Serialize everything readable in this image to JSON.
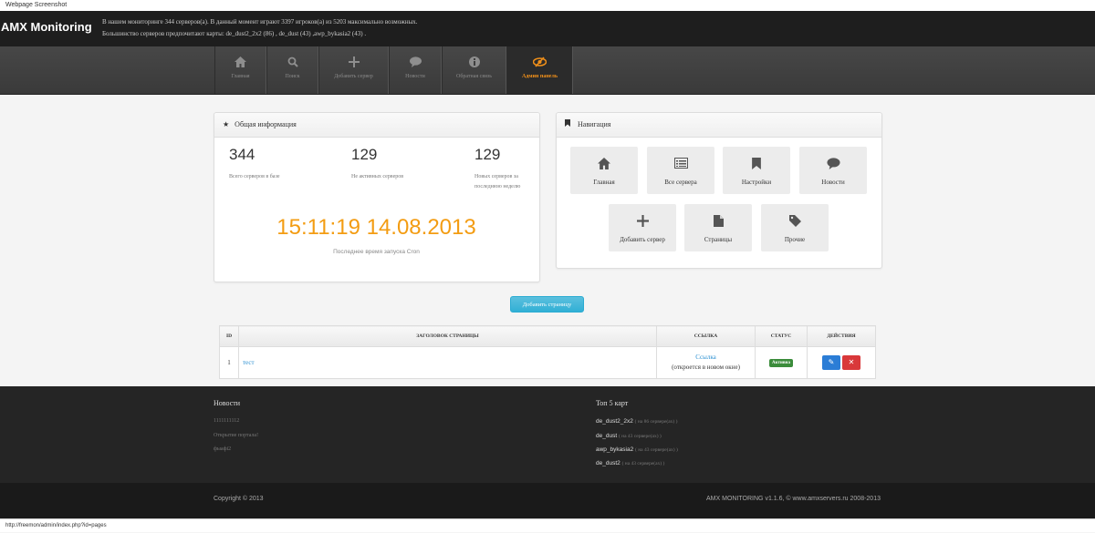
{
  "window_title": "Webpage Screenshot",
  "brand": "AMX Monitoring",
  "top_info": {
    "line1": "В нашем мониторинге 344 серверов(а). В данный момент играют 3397 игроков(а) из 5203 максимально возможных.",
    "line2": "Большинство серверов предпочитают карты: de_dust2_2x2 (86) , de_dust (43) ,awp_bykasia2 (43) ."
  },
  "nav": [
    {
      "icon": "home-icon",
      "label": "Главная"
    },
    {
      "icon": "search-icon",
      "label": "Поиск"
    },
    {
      "icon": "plus-icon",
      "label": "Добавить сервер"
    },
    {
      "icon": "chat-icon",
      "label": "Новости"
    },
    {
      "icon": "info-icon",
      "label": "Обратная связь"
    },
    {
      "icon": "eye-slash-icon",
      "label": "Админ панель",
      "active": true
    }
  ],
  "overview": {
    "title": "Общая информация",
    "stats": [
      {
        "value": "344",
        "caption": "Всего серверов в базе"
      },
      {
        "value": "129",
        "caption": "Не активных серверов"
      },
      {
        "value": "129",
        "caption": "Новых серверов за последнюю неделю"
      }
    ],
    "cron_time": "15:11:19 14.08.2013",
    "cron_caption": "Последнее время запуска Cron"
  },
  "navigation": {
    "title": "Навигация",
    "tiles": [
      {
        "icon": "home-icon",
        "label": "Главная"
      },
      {
        "icon": "list-icon",
        "label": "Все сервера"
      },
      {
        "icon": "bookmark-icon",
        "label": "Настройки"
      },
      {
        "icon": "chat-icon",
        "label": "Новости"
      },
      {
        "icon": "plus-icon",
        "label": "Добавить сервер"
      },
      {
        "icon": "file-icon",
        "label": "Страницы"
      },
      {
        "icon": "tag-icon",
        "label": "Прочие"
      }
    ]
  },
  "add_page_button": "Добавить страницу",
  "table": {
    "headers": [
      "ID",
      "Заголовок страницы",
      "Ссылка",
      "Статус",
      "Действия"
    ],
    "rows": [
      {
        "id": "1",
        "title": "тест",
        "link": "Ссылка",
        "link_note": "(откроется в новом окне)",
        "status": "Активна"
      }
    ]
  },
  "footer": {
    "news_title": "Новости",
    "news": [
      "1111111112",
      "Открытие портала!",
      "фыафі2"
    ],
    "maps_title": "Топ 5 карт",
    "maps": [
      {
        "name": "de_dust2_2x2",
        "count": "( на 86 сервере(ах) )"
      },
      {
        "name": "de_dust",
        "count": "( на 43 сервере(ах) )"
      },
      {
        "name": "awp_bykasia2",
        "count": "( на 43 сервере(ах) )"
      },
      {
        "name": "de_dust2",
        "count": "( на 43 сервере(ах) )"
      }
    ],
    "copyright": "Copyright © 2013",
    "credits": "AMX MONITORING v1.1.6, © www.amxservers.ru 2008-2013"
  },
  "status_url": "http://freemon/admin/index.php?id=pages",
  "colors": {
    "accent": "#f39c12",
    "info": "#5bc0de",
    "success": "#3b8c3b",
    "danger": "#d9383a",
    "primary": "#2b7dd6"
  }
}
